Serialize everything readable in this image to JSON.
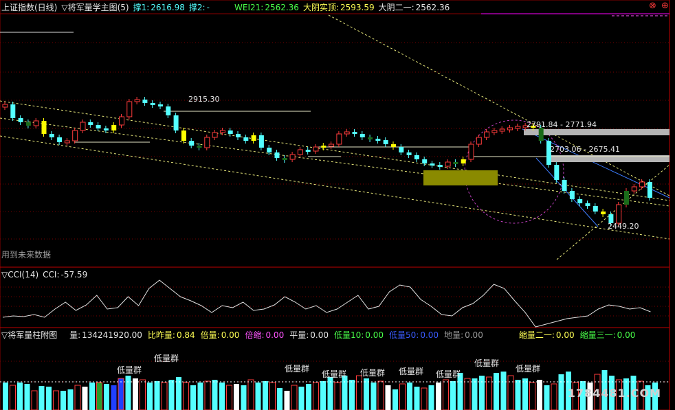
{
  "header": {
    "index_name": "上证指数(日线)",
    "indicator": "▽将军量学主图(5)",
    "support1_label": "撑1:",
    "support1_value": "2616.98",
    "support2_label": "撑2:",
    "support2_value": "-",
    "wei21_label": "WEI21:",
    "wei21_value": "2562.36",
    "dayin_label": "大阴实顶:",
    "dayin_value": "2593.59",
    "dayin2_label": "大阴二一:",
    "dayin2_value": "2562.36"
  },
  "window_controls": {
    "close": "⊗",
    "restore": "⊕"
  },
  "annotations": {
    "p2915": "2915.30",
    "p2791": "2791.84 - 2771.94",
    "p2703": "2703.06 - 2675.41",
    "p2449": "2449.20",
    "future_note": "用到未来数据"
  },
  "cci": {
    "name": "▽CCI(14)",
    "label": "CCI:",
    "value": "-57.59"
  },
  "volume": {
    "name": "▽将军量柱附图",
    "items": [
      {
        "label": "量:",
        "value": "134241920.00",
        "color": "white"
      },
      {
        "label": "比昨量:",
        "value": "0.84",
        "color": "yellow"
      },
      {
        "label": "倍量:",
        "value": "0.00",
        "color": "yellow"
      },
      {
        "label": "倍缩:",
        "value": "0.00",
        "color": "mag"
      },
      {
        "label": "平量:",
        "value": "0.00",
        "color": "white"
      },
      {
        "label": "低量10:",
        "value": "0.00",
        "color": "green"
      },
      {
        "label": "低量50:",
        "value": "0.00",
        "color": "blue"
      },
      {
        "label": "地量:",
        "value": "0.00",
        "color": "gray"
      },
      {
        "label": "缩量二一:",
        "value": "0.00",
        "color": "yellow"
      },
      {
        "label": "缩量三一:",
        "value": "0.00",
        "color": "green"
      }
    ],
    "low_volume_tags": [
      "低量群",
      "低量群",
      "低量群",
      "低量群",
      "低量群",
      "低量群",
      "低量群",
      "低量群",
      "低量群"
    ]
  },
  "watermark": "1784481.COM",
  "colors": {
    "up": "#ff3c3c",
    "down": "#54ffff",
    "yellow": "#ffff00",
    "olive": "#8a8a00",
    "grid": "#7a0000",
    "gray": "#b4b4b4"
  }
}
